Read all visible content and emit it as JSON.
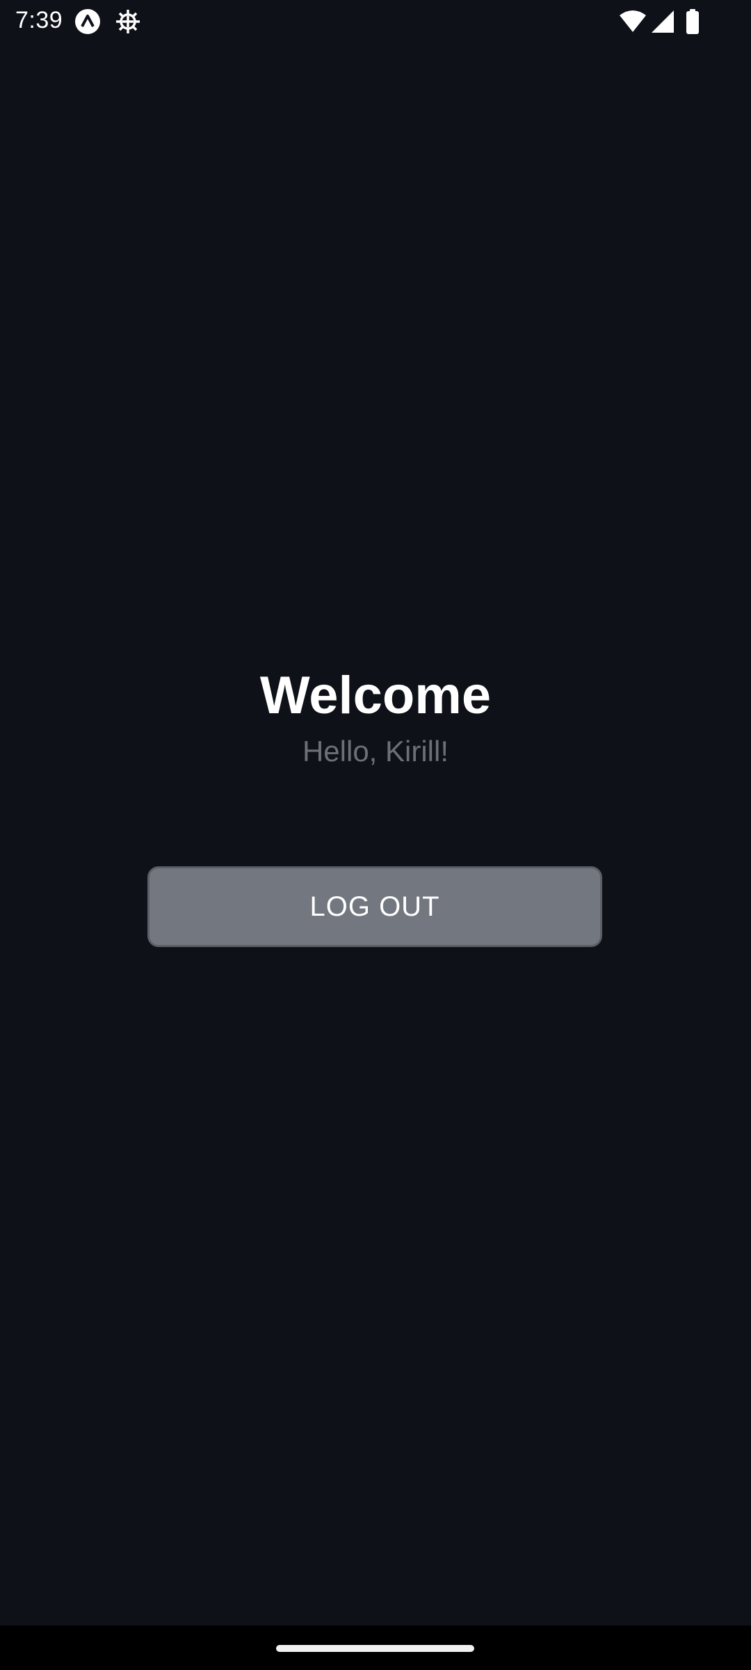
{
  "status_bar": {
    "time": "7:39",
    "icons": [
      "app-notification-icon",
      "gear-icon",
      "wifi-icon",
      "cellular-signal-icon",
      "battery-icon"
    ]
  },
  "main": {
    "title": "Welcome",
    "greeting": "Hello, Kirill!",
    "logout_label": "LOG OUT"
  },
  "colors": {
    "background": "#0e1118",
    "button": "#737780",
    "subtitle": "#6b7079",
    "text": "#ffffff"
  }
}
